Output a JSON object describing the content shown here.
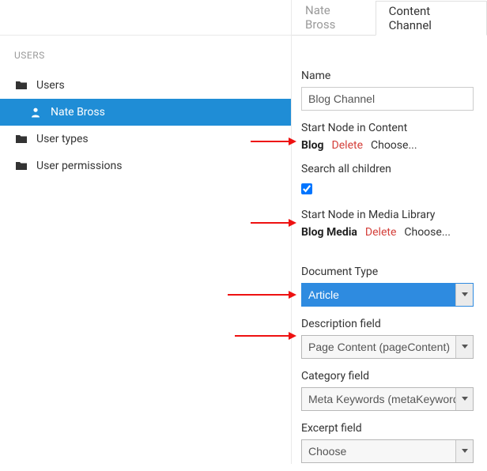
{
  "sidebar": {
    "heading": "USERS",
    "items": [
      {
        "label": "Users",
        "icon": "folder-icon",
        "selected": false,
        "child": false
      },
      {
        "label": "Nate Bross",
        "icon": "user-icon",
        "selected": true,
        "child": true
      },
      {
        "label": "User types",
        "icon": "folder-icon",
        "selected": false,
        "child": false
      },
      {
        "label": "User permissions",
        "icon": "folder-icon",
        "selected": false,
        "child": false
      }
    ]
  },
  "tabs": {
    "inactive": "Nate Bross",
    "active": "Content Channel"
  },
  "form": {
    "name_label": "Name",
    "name_value": "Blog Channel",
    "start_content_label": "Start Node in Content",
    "start_content_node": "Blog",
    "delete_label": "Delete",
    "choose_label": "Choose...",
    "search_children_label": "Search all children",
    "search_children_checked": true,
    "start_media_label": "Start Node in Media Library",
    "start_media_node": "Blog Media",
    "doctype_label": "Document Type",
    "doctype_value": "Article",
    "description_label": "Description field",
    "description_value": "Page Content (pageContent)",
    "category_label": "Category field",
    "category_value": "Meta Keywords (metaKeywords)",
    "excerpt_label": "Excerpt field",
    "excerpt_value": "Choose"
  }
}
